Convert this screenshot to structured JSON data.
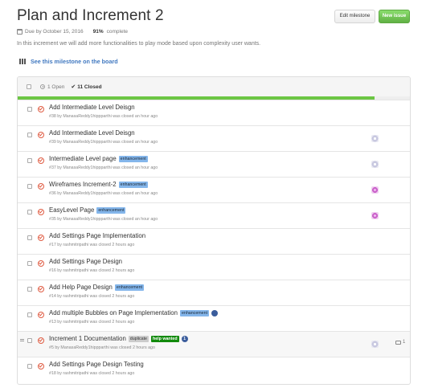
{
  "milestone": {
    "title": "Plan and Increment 2",
    "due": "Due by October 15, 2016",
    "percent": "91%",
    "percent_label": "complete",
    "progress_fraction": 0.91,
    "description": "In this increment we will add more functionalities to play mode based upon complexity user wants.",
    "board_link": "See this milestone on the board"
  },
  "buttons": {
    "edit": "Edit milestone",
    "new_issue": "New issue"
  },
  "list_header": {
    "open": "1 Open",
    "closed_check": "✔",
    "closed": "11 Closed"
  },
  "issues": [
    {
      "title": "Add Intermediate Level Deisgn",
      "meta": "#38 by ManasaReddy1hippparthi was closed an hour ago",
      "labels": [],
      "avatar": "none"
    },
    {
      "title": "Add Intermediate Level Deisgn",
      "meta": "#39 by ManasaReddy1hippparthi was closed an hour ago",
      "labels": [],
      "avatar": "grey"
    },
    {
      "title": "Intermediate Level page",
      "meta": "#37 by ManasaReddy1hippparthi was closed an hour ago",
      "labels": [
        "enhancement"
      ],
      "avatar": "grey"
    },
    {
      "title": "Wireframes Increment-2",
      "meta": "#36 by ManasaReddy1hippparthi was closed an hour ago",
      "labels": [
        "enhancement"
      ],
      "avatar": "pink"
    },
    {
      "title": "EasyLevel Page",
      "meta": "#35 by ManasaReddy1hippparthi was closed an hour ago",
      "labels": [
        "enhancement"
      ],
      "avatar": "pink"
    },
    {
      "title": "Add Settings Page Implementation",
      "meta": "#17 by rashmitripathi was closed 2 hours ago",
      "labels": [],
      "avatar": "none"
    },
    {
      "title": "Add Settings Page Design",
      "meta": "#16 by rashmitripathi was closed 2 hours ago",
      "labels": [],
      "avatar": "none"
    },
    {
      "title": "Add Help Page Design",
      "meta": "#14 by rashmitripathi was closed 2 hours ago",
      "labels": [
        "enhancement"
      ],
      "avatar": "none"
    },
    {
      "title": "Add multiple Bubbles on Page Implementation",
      "meta": "#13 by rashmitripathi was closed 2 hours ago",
      "labels": [
        "enhancement"
      ],
      "avatar": "none",
      "badge": true
    },
    {
      "title": "Increment 1 Documentation",
      "meta": "#5 by ManasaReddy1hippparthi was closed 2 hours ago",
      "labels": [
        "duplicate",
        "help wanted"
      ],
      "avatar": "grey",
      "badge_count": "1",
      "comments": "1"
    },
    {
      "title": "Add Settings Page Design Testing",
      "meta": "#18 by rashmitripathi was closed 2 hours ago",
      "labels": [],
      "avatar": "none"
    }
  ],
  "colors": {
    "enhancement": "#84b6eb",
    "duplicate": "#cccccc",
    "help_wanted": "#128a0c",
    "progress": "#6cc644",
    "closed_icon": "#e05d44"
  }
}
